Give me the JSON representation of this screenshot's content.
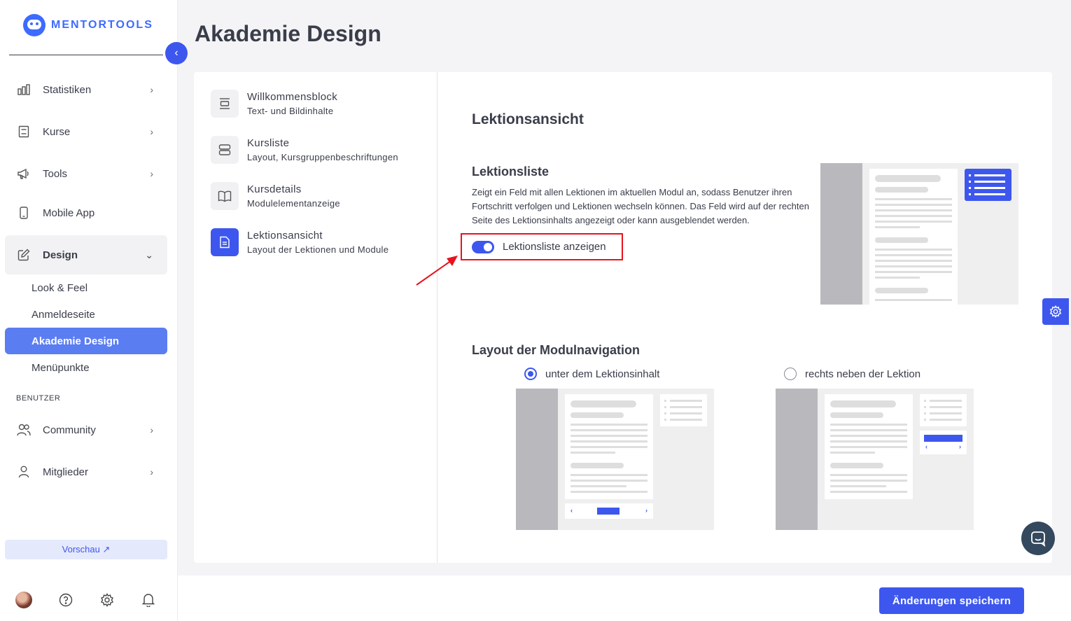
{
  "brand": {
    "name": "MENTORTOOLS"
  },
  "sidebar": {
    "items": [
      {
        "label": "Statistiken",
        "icon": "bar-chart-icon"
      },
      {
        "label": "Kurse",
        "icon": "book-icon"
      },
      {
        "label": "Tools",
        "icon": "megaphone-icon"
      },
      {
        "label": "Mobile App",
        "icon": "phone-icon"
      },
      {
        "label": "Design",
        "icon": "edit-icon"
      }
    ],
    "design_sub": [
      "Look & Feel",
      "Anmeldeseite",
      "Akademie Design",
      "Menüpunkte"
    ],
    "section_benutzer": "BENUTZER",
    "user_items": [
      {
        "label": "Community",
        "icon": "users-icon"
      },
      {
        "label": "Mitglieder",
        "icon": "user-icon"
      }
    ],
    "preview": "Vorschau ↗"
  },
  "page": {
    "title": "Akademie Design"
  },
  "settings_menu": [
    {
      "title": "Willkommensblock",
      "subtitle": "Text- und Bildinhalte"
    },
    {
      "title": "Kursliste",
      "subtitle": "Layout, Kursgruppenbeschriftungen"
    },
    {
      "title": "Kursdetails",
      "subtitle": "Modulelementanzeige"
    },
    {
      "title": "Lektionsansicht",
      "subtitle": "Layout der Lektionen und Module"
    }
  ],
  "content": {
    "section_title": "Lektionsansicht",
    "list_title": "Lektionsliste",
    "list_description": "Zeigt ein Feld mit allen Lektionen im aktuellen Modul an, sodass Benutzer ihren Fortschritt verfolgen und Lektionen wechseln können. Das Feld wird auf der rechten Seite des Lektionsinhalts angezeigt oder kann ausgeblendet werden.",
    "toggle_label": "Lektionsliste anzeigen",
    "toggle_on": true,
    "layout_title": "Layout der Modulnavigation",
    "option_below": "unter dem Lektionsinhalt",
    "option_right": "rechts neben der Lektion",
    "selected_option": "unter dem Lektionsinhalt"
  },
  "footer": {
    "save_label": "Änderungen speichern"
  },
  "colors": {
    "accent": "#3d57ee",
    "highlight": "#e8131e"
  }
}
